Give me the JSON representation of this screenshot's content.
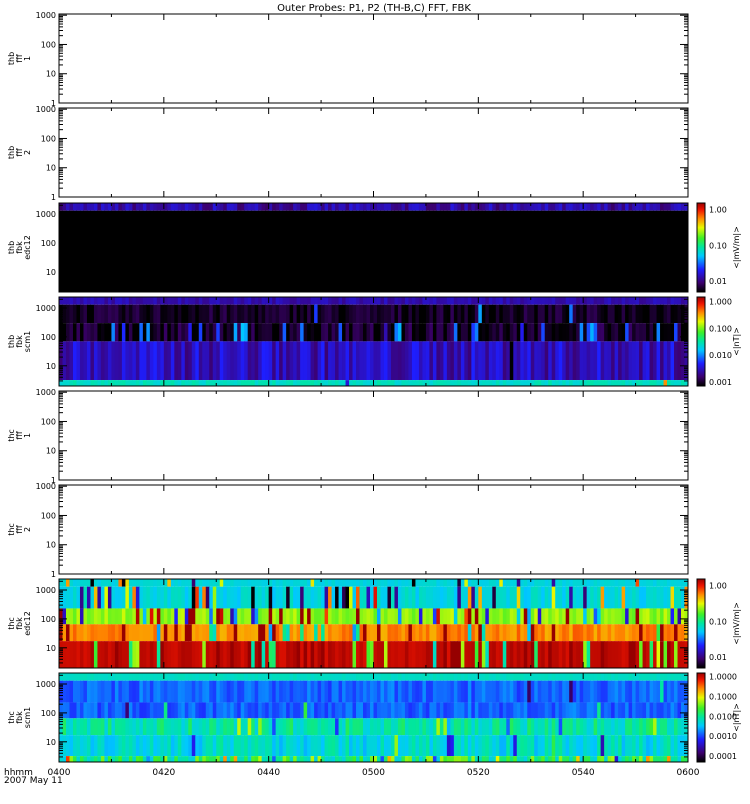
{
  "chart_data": {
    "type": "heatmap",
    "title": "Outer Probes: P1, P2 (TH-B,C) FFT, FBK",
    "xlabel": "hhmm",
    "date_label": "2007 May 11",
    "xticks": [
      "0400",
      "0420",
      "0440",
      "0500",
      "0520",
      "0540",
      "0600"
    ],
    "xrange_minutes": [
      240,
      360
    ],
    "panels": [
      {
        "label": [
          "thb",
          "fff",
          "1"
        ],
        "kind": "empty",
        "yticks": [
          "1",
          "10",
          "100",
          "1000"
        ],
        "ylim": [
          1,
          1100
        ]
      },
      {
        "label": [
          "thb",
          "fff",
          "2"
        ],
        "kind": "empty",
        "yticks": [
          "1",
          "10",
          "100",
          "1000"
        ],
        "ylim": [
          1,
          1100
        ]
      },
      {
        "label": [
          "thb",
          "fbk",
          "edc12"
        ],
        "kind": "spec",
        "yticks": [
          "10",
          "100",
          "1000"
        ],
        "ylim": [
          2,
          2400
        ],
        "colorbar": {
          "title": "<|mV/m|>",
          "ticks": [
            "0.01",
            "0.10",
            "1.00"
          ],
          "range": [
            0.005,
            1.5
          ]
        },
        "bands": [
          {
            "lo": 1300,
            "hi": 2400,
            "value": 0.012,
            "spread": 0.3,
            "burst": 0
          },
          {
            "lo": 2,
            "hi": 1300,
            "value": 0.003,
            "spread": 0,
            "burst": 0
          }
        ]
      },
      {
        "label": [
          "thb",
          "fbk",
          "scm1"
        ],
        "kind": "spec",
        "yticks": [
          "10",
          "100",
          "1000"
        ],
        "ylim": [
          2,
          2400
        ],
        "colorbar": {
          "title": "<|nT|>",
          "ticks": [
            "0.001",
            "0.010",
            "0.100",
            "1.000"
          ],
          "range": [
            0.0007,
            1.5
          ]
        },
        "bands": [
          {
            "lo": 1300,
            "hi": 2400,
            "value": 0.0025,
            "spread": 0.2,
            "burst": 0
          },
          {
            "lo": 300,
            "hi": 1300,
            "value": 0.0009,
            "spread": 0.3,
            "burst": 0.03
          },
          {
            "lo": 70,
            "hi": 300,
            "value": 0.0009,
            "spread": 0.4,
            "burst": 0.3
          },
          {
            "lo": 3.2,
            "hi": 70,
            "value": 0.0028,
            "spread": 0.5,
            "burst": 0.02
          },
          {
            "lo": 2,
            "hi": 3.2,
            "value": 0.025,
            "spread": 0.2,
            "burst": 0.01
          }
        ]
      },
      {
        "label": [
          "thc",
          "fff",
          "1"
        ],
        "kind": "empty",
        "yticks": [
          "1",
          "10",
          "100",
          "1000"
        ],
        "ylim": [
          1,
          1100
        ]
      },
      {
        "label": [
          "thc",
          "fff",
          "2"
        ],
        "kind": "empty",
        "yticks": [
          "1",
          "10",
          "100",
          "1000"
        ],
        "ylim": [
          1,
          1100
        ]
      },
      {
        "label": [
          "thc",
          "fbk",
          "edc12"
        ],
        "kind": "spec",
        "yticks": [
          "10",
          "100",
          "1000"
        ],
        "ylim": [
          2,
          2400
        ],
        "colorbar": {
          "title": "<|mV/m|>",
          "ticks": [
            "0.01",
            "0.10",
            "1.00"
          ],
          "range": [
            0.005,
            1.5
          ]
        },
        "bands": [
          {
            "lo": 1300,
            "hi": 2400,
            "value": 0.06,
            "spread": 0.1,
            "burst": 0.05
          },
          {
            "lo": 230,
            "hi": 1300,
            "value": 0.06,
            "spread": 0.2,
            "burst": 0.25
          },
          {
            "lo": 65,
            "hi": 230,
            "value": 0.22,
            "spread": 0.2,
            "burst": 0.25
          },
          {
            "lo": 17,
            "hi": 65,
            "value": 0.55,
            "spread": 0.2,
            "burst": 0.25
          },
          {
            "lo": 2,
            "hi": 17,
            "value": 1.2,
            "spread": 0.1,
            "burst": 0.25
          }
        ]
      },
      {
        "label": [
          "thc",
          "fbk",
          "scm1"
        ],
        "kind": "spec",
        "yticks": [
          "10",
          "100",
          "1000"
        ],
        "ylim": [
          2,
          2400
        ],
        "colorbar": {
          "title": "<|nT|>",
          "ticks": [
            "0.0001",
            "0.0010",
            "0.0100",
            "0.1000",
            "1.0000"
          ],
          "range": [
            5e-05,
            1.5
          ]
        },
        "bands": [
          {
            "lo": 1300,
            "hi": 2400,
            "value": 0.006,
            "spread": 0.1,
            "burst": 0
          },
          {
            "lo": 230,
            "hi": 1300,
            "value": 0.0012,
            "spread": 0.4,
            "burst": 0.02
          },
          {
            "lo": 65,
            "hi": 230,
            "value": 0.0012,
            "spread": 0.4,
            "burst": 0.02
          },
          {
            "lo": 17,
            "hi": 65,
            "value": 0.008,
            "spread": 0.6,
            "burst": 0.05
          },
          {
            "lo": 3.2,
            "hi": 17,
            "value": 0.005,
            "spread": 0.6,
            "burst": 0.05
          },
          {
            "lo": 2,
            "hi": 3.2,
            "value": 0.015,
            "spread": 1.2,
            "burst": 0.1
          }
        ]
      }
    ]
  }
}
